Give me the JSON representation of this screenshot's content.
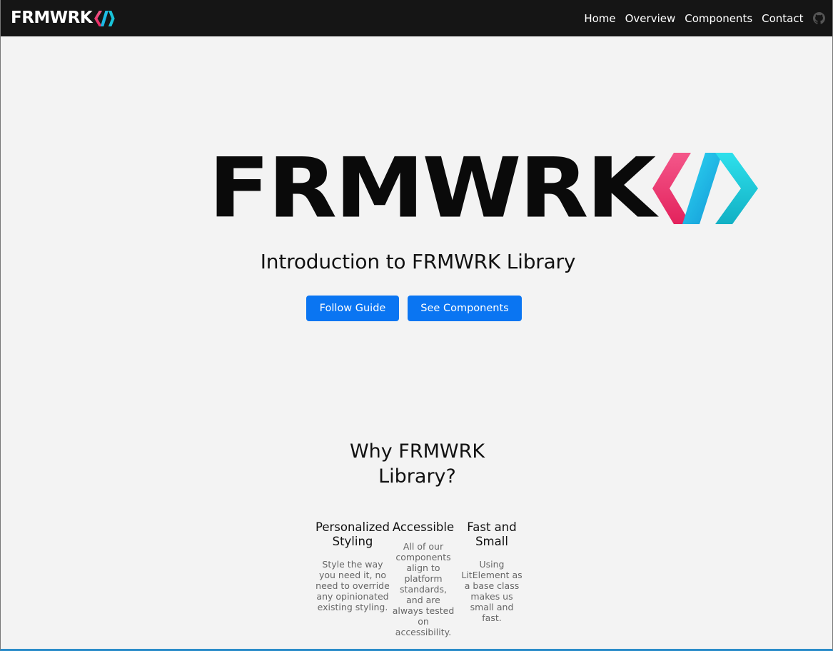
{
  "nav": {
    "brand": "FRMWRK",
    "links": [
      "Home",
      "Overview",
      "Components",
      "Contact"
    ],
    "github_icon": "github-icon"
  },
  "hero": {
    "logo_text": "FRMWRK",
    "title": "Introduction to FRMWRK Library",
    "buttons": {
      "guide": "Follow Guide",
      "components": "See Components"
    }
  },
  "why": {
    "title_line1": "Why FRMWRK",
    "title_line2": "Library?",
    "features": [
      {
        "title": "Personalized Styling",
        "text": "Style the way you need it, no need to override any opinionated existing styling."
      },
      {
        "title": "Accessible",
        "text": "All of our components align to platform standards, and are always tested on accessibility."
      },
      {
        "title": "Fast and Small",
        "text": "Using LitElement as a base class makes us small and fast."
      }
    ]
  },
  "colors": {
    "navbar_bg": "#151515",
    "page_bg": "#f3f3f3",
    "button_bg": "#0a75f2",
    "logo_pink": "#f0457a",
    "logo_cyan": "#22b8e8"
  }
}
